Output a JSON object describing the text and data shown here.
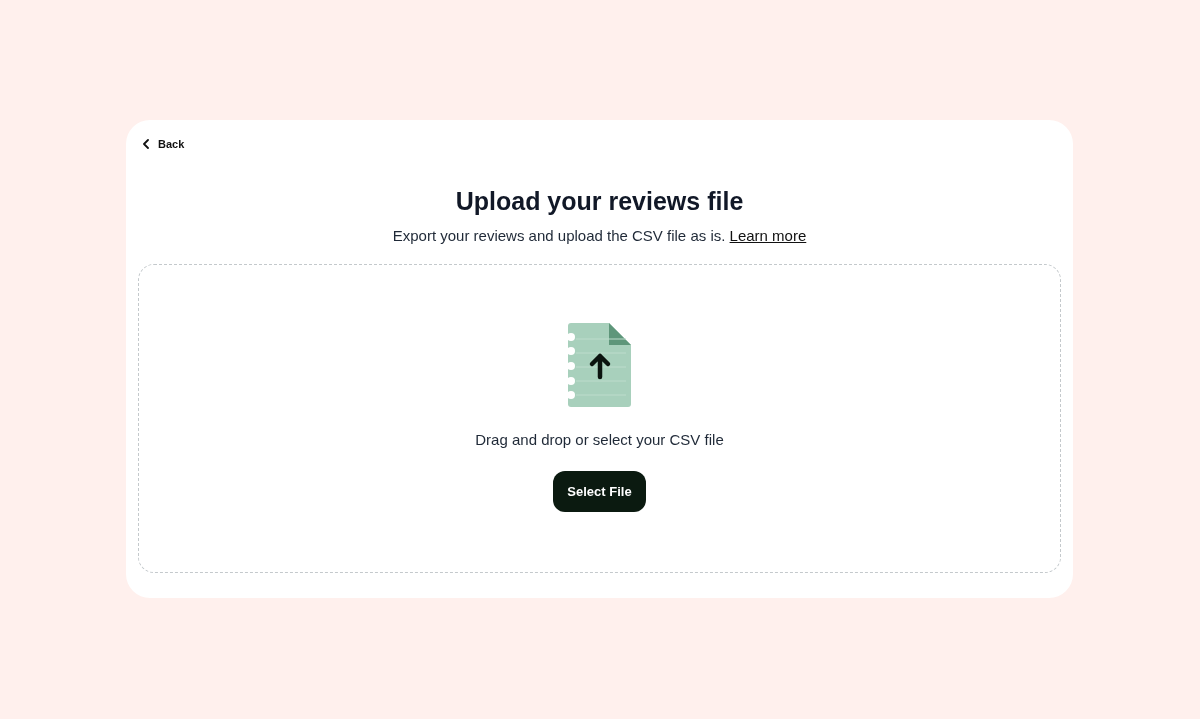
{
  "back": {
    "label": "Back"
  },
  "heading": "Upload your reviews file",
  "subtitle": {
    "text": "Export your reviews and upload the CSV file as is.",
    "link": "Learn more"
  },
  "dropzone": {
    "prompt": "Drag and drop or select your CSV file",
    "button": "Select File"
  }
}
